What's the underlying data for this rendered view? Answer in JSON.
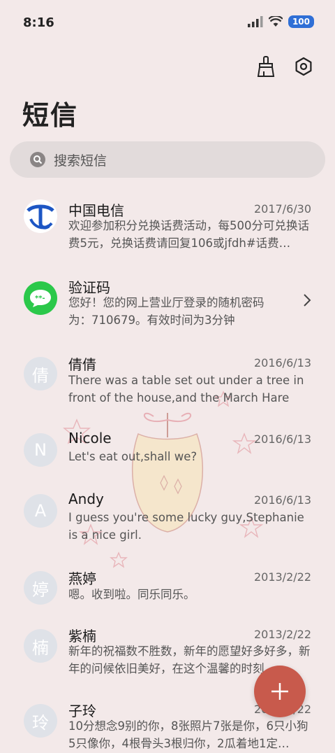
{
  "status": {
    "time": "8:16",
    "battery": "100"
  },
  "header": {
    "title": "短信"
  },
  "search": {
    "placeholder": "搜索短信"
  },
  "conversations": [
    {
      "name": "中国电信",
      "date": "2017/6/30",
      "avatar": "",
      "preview": "欢迎参加积分兑换话费活动，每500分可兑换话费5元，兑换话费请回复106或jfdh#话费…"
    },
    {
      "name": "验证码",
      "date": "",
      "avatar": "",
      "preview": "您好！您的网上营业厅登录的随机密码为：710679。有效时间为3分钟"
    },
    {
      "name": "倩倩",
      "date": "2016/6/13",
      "avatar": "倩",
      "preview": "There was a table set out under a tree in front of the house,and the March Hare an…"
    },
    {
      "name": "Nicole",
      "date": "2016/6/13",
      "avatar": "N",
      "preview": "Let's eat out,shall we?"
    },
    {
      "name": "Andy",
      "date": "2016/6/13",
      "avatar": "A",
      "preview": "I guess you're some lucky guy,Stephanie is a nice girl."
    },
    {
      "name": "燕婷",
      "date": "2013/2/22",
      "avatar": "婷",
      "preview": "嗯。收到啦。同乐同乐。"
    },
    {
      "name": "紫楠",
      "date": "2013/2/22",
      "avatar": "楠",
      "preview": "新年的祝福数不胜数，新年的愿望好多好多，新年的问候依旧美好，在这个温馨的时刻…"
    },
    {
      "name": "子玲",
      "date": "2013/2/22",
      "avatar": "玲",
      "preview": "10分想念9别的你，8张照片7张是你，6只小狗5只像你，4根骨头3根归你，2瓜着地1定…"
    }
  ],
  "colors": {
    "fab": "#c85a4c",
    "telecom": "#1d56c4",
    "otp": "#2bc84a",
    "background": "#f3e9e9"
  },
  "icons": [
    "signal-icon",
    "wifi-icon",
    "broom-icon",
    "settings-icon",
    "search-icon",
    "chevron-right-icon",
    "plus-icon"
  ]
}
